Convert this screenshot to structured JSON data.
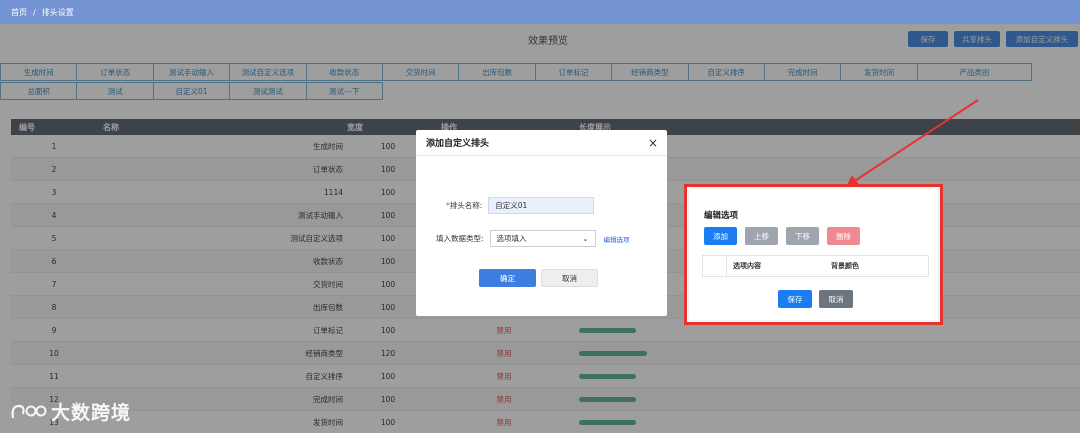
{
  "breadcrumb": {
    "home": "首页",
    "separator": "/",
    "current": "排头设置"
  },
  "preview_title": "效果预览",
  "actions": {
    "save": "保存",
    "share": "共享排头",
    "add_custom": "添加自定义排头"
  },
  "chips_row1": [
    "生成时间",
    "订单状态",
    "测试手动输入",
    "测试自定义选项",
    "收款状态",
    "交货时间",
    "出库包数",
    "订单标记",
    "经销商类型",
    "自定义排序",
    "完成时间",
    "发货时间",
    "产品类别"
  ],
  "chips_row2": [
    "总面积",
    "测试",
    "自定义01",
    "测试测试",
    "测试---下"
  ],
  "table": {
    "headers": [
      "编号",
      "名称",
      "宽度",
      "操作",
      "长度展示"
    ],
    "rows": [
      {
        "no": "1",
        "name": "生成时间",
        "width": "100",
        "op": "",
        "len": 0
      },
      {
        "no": "2",
        "name": "订单状态",
        "width": "100",
        "op": "",
        "len": 0
      },
      {
        "no": "3",
        "name": "1114",
        "width": "100",
        "op": "",
        "len": 0
      },
      {
        "no": "4",
        "name": "测试手动输入",
        "width": "100",
        "op": "",
        "len": 0
      },
      {
        "no": "5",
        "name": "测试自定义选项",
        "width": "100",
        "op": "",
        "len": 0
      },
      {
        "no": "6",
        "name": "收款状态",
        "width": "100",
        "op": "",
        "len": 0
      },
      {
        "no": "7",
        "name": "交货时间",
        "width": "100",
        "op": "",
        "len": 0
      },
      {
        "no": "8",
        "name": "出库包数",
        "width": "100",
        "op": "禁用",
        "len": 100
      },
      {
        "no": "9",
        "name": "订单标记",
        "width": "100",
        "op": "禁用",
        "len": 100
      },
      {
        "no": "10",
        "name": "经销商类型",
        "width": "120",
        "op": "禁用",
        "len": 120
      },
      {
        "no": "11",
        "name": "自定义排序",
        "width": "100",
        "op": "禁用",
        "len": 100
      },
      {
        "no": "12",
        "name": "完成时间",
        "width": "100",
        "op": "禁用",
        "len": 100
      },
      {
        "no": "13",
        "name": "发货时间",
        "width": "100",
        "op": "禁用",
        "len": 100
      }
    ]
  },
  "modal": {
    "title": "添加自定义排头",
    "close": "×",
    "name_required": "*",
    "name_label": "排头名称:",
    "name_value": "自定义01",
    "type_label": "填入数据类型:",
    "type_value": "选项填入",
    "type_arrow": "⌄",
    "edit_options": "编辑选项",
    "ok": "确定",
    "cancel": "取消"
  },
  "edit_panel": {
    "title": "编辑选项",
    "add": "添加",
    "up": "上移",
    "down": "下移",
    "delete": "删除",
    "col_content": "选项内容",
    "col_bg": "背景颜色",
    "save": "保存",
    "cancel": "取消"
  },
  "colors": {
    "topbar": "#7393d3",
    "primary": "#1a7ef2",
    "danger_border": "#e8322e",
    "bar": "#61b79a",
    "disabled_text": "#e2565c"
  },
  "watermark": "大数跨境"
}
